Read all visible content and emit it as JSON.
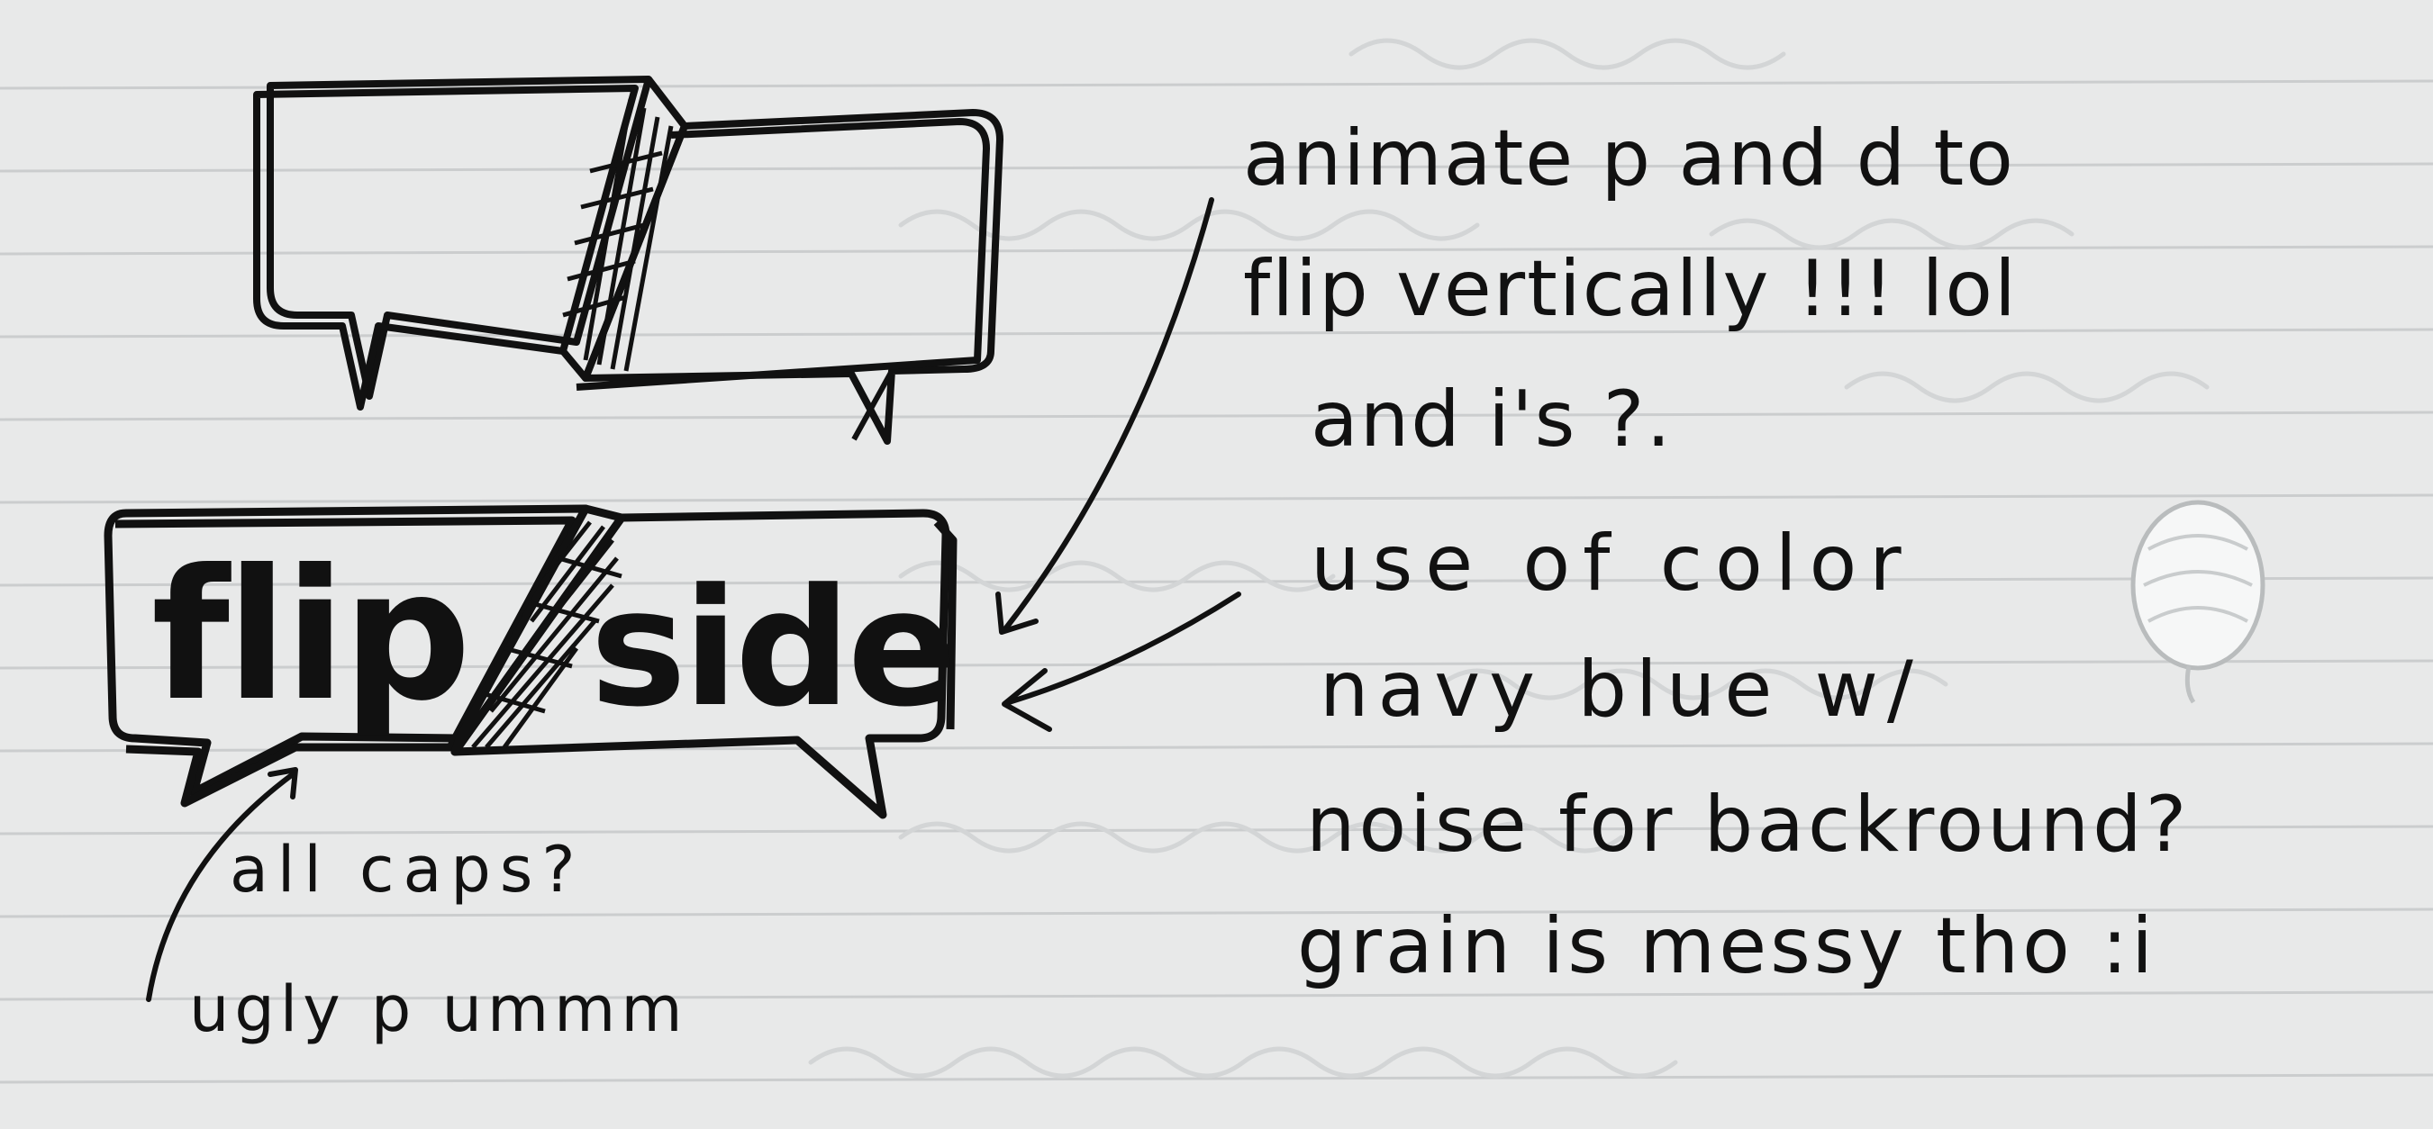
{
  "logo": {
    "word_left": "flip",
    "word_right": "side"
  },
  "notes": {
    "line_1": "animate p and d to",
    "line_2": "flip vertically !!! lol",
    "line_3": "and i's ?.",
    "line_4": "use of color",
    "line_5": "navy blue w/",
    "line_6": "noise for backround?",
    "line_7": "grain is messy tho :i",
    "caps_note": "all caps?",
    "ugly_note": "ugly p ummm"
  },
  "colors": {
    "paper": "#e9eaea",
    "ink": "#111111",
    "rule_line": "#c8cbcc",
    "ghost_text": "#cfd1d2"
  }
}
